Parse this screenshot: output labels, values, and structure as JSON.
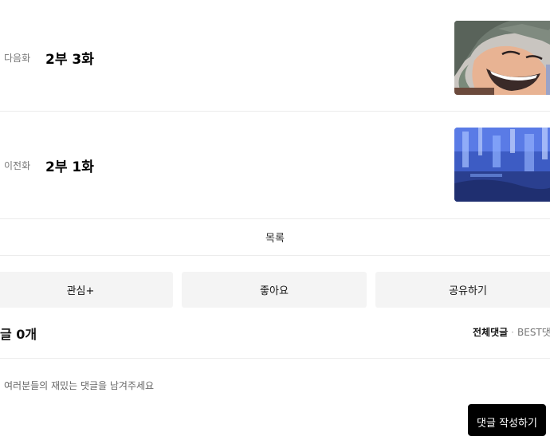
{
  "episodes": [
    {
      "kind": "다음화",
      "title": "2부 3화",
      "thumb": "thumbnail-face"
    },
    {
      "kind": "이전화",
      "title": "2부 1화",
      "thumb": "thumbnail-blue-scene"
    }
  ],
  "list_label": "목록",
  "actions": {
    "subscribe": "관심+",
    "like": "좋아요",
    "share": "공유하기"
  },
  "comments": {
    "count_text": "글 0개",
    "tab_all": "전체댓글",
    "tab_separator": "·",
    "tab_best": "BEST댓",
    "placeholder": "여러분들의 재밌는 댓글을 남겨주세요",
    "write_button": "댓글 작성하기"
  }
}
